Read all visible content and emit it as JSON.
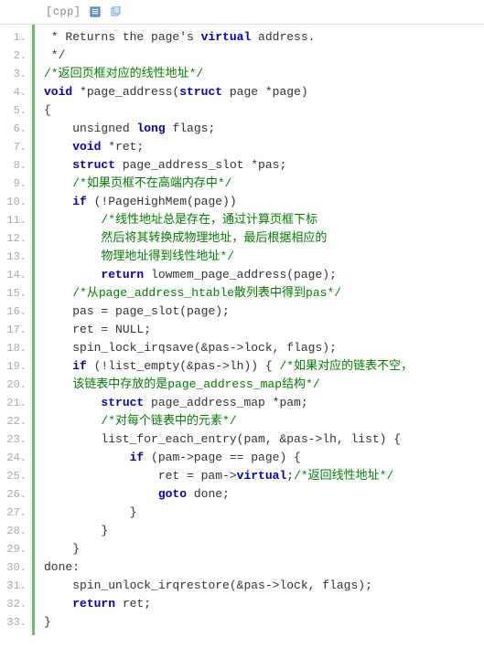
{
  "header": {
    "lang": "[cpp]",
    "icon1": "view-plain",
    "icon2": "copy"
  },
  "lines": {
    "1": {
      "pre": " * Returns the page's ",
      "kw": "virtual",
      "post": " address."
    },
    "2": " */",
    "3": "/*返回页框对应的线性地址*/",
    "4": {
      "kw1": "void",
      "mid": " *page_address(",
      "kw2": "struct",
      "post": " page *page)"
    },
    "5": "{",
    "6": {
      "pre": "unsigned ",
      "kw": "long",
      "post": " flags;"
    },
    "7": {
      "kw": "void",
      "post": " *ret;"
    },
    "8": {
      "kw": "struct",
      "post": " page_address_slot *pas;"
    },
    "9": "/*如果页框不在高端内存中*/",
    "10": {
      "kw": "if",
      "post": " (!PageHighMem(page))"
    },
    "11": "/*线性地址总是存在，通过计算页框下标",
    "12": "然后将其转换成物理地址，最后根据相应的",
    "13": "物理地址得到线性地址*/",
    "14": {
      "kw": "return",
      "post": " lowmem_page_address(page);"
    },
    "15": "/*从page_address_htable散列表中得到pas*/",
    "16": "pas = page_slot(page);",
    "17": "ret = NULL;",
    "18": "spin_lock_irqsave(&pas->lock, flags);",
    "19": {
      "kw": "if",
      "mid": " (!list_empty(&pas->lh)) { ",
      "cm": "/*如果对应的链表不空，"
    },
    "20": "该链表中存放的是page_address_map结构*/",
    "21": {
      "kw": "struct",
      "post": " page_address_map *pam;"
    },
    "22": "/*对每个链表中的元素*/",
    "23": "list_for_each_entry(pam, &pas->lh, list) {",
    "24": {
      "kw": "if",
      "post": " (pam->page == page) {"
    },
    "25": {
      "pre": "ret = pam->",
      "kw": "virtual",
      "post": ";",
      "cm": "/*返回线性地址*/"
    },
    "26": {
      "kw": "goto",
      "post": " done;"
    },
    "27": "}",
    "28": "}",
    "29": "}",
    "30": "done:",
    "31": "spin_unlock_irqrestore(&pas->lock, flags);",
    "32": {
      "kw": "return",
      "post": " ret;"
    },
    "33": "}"
  }
}
